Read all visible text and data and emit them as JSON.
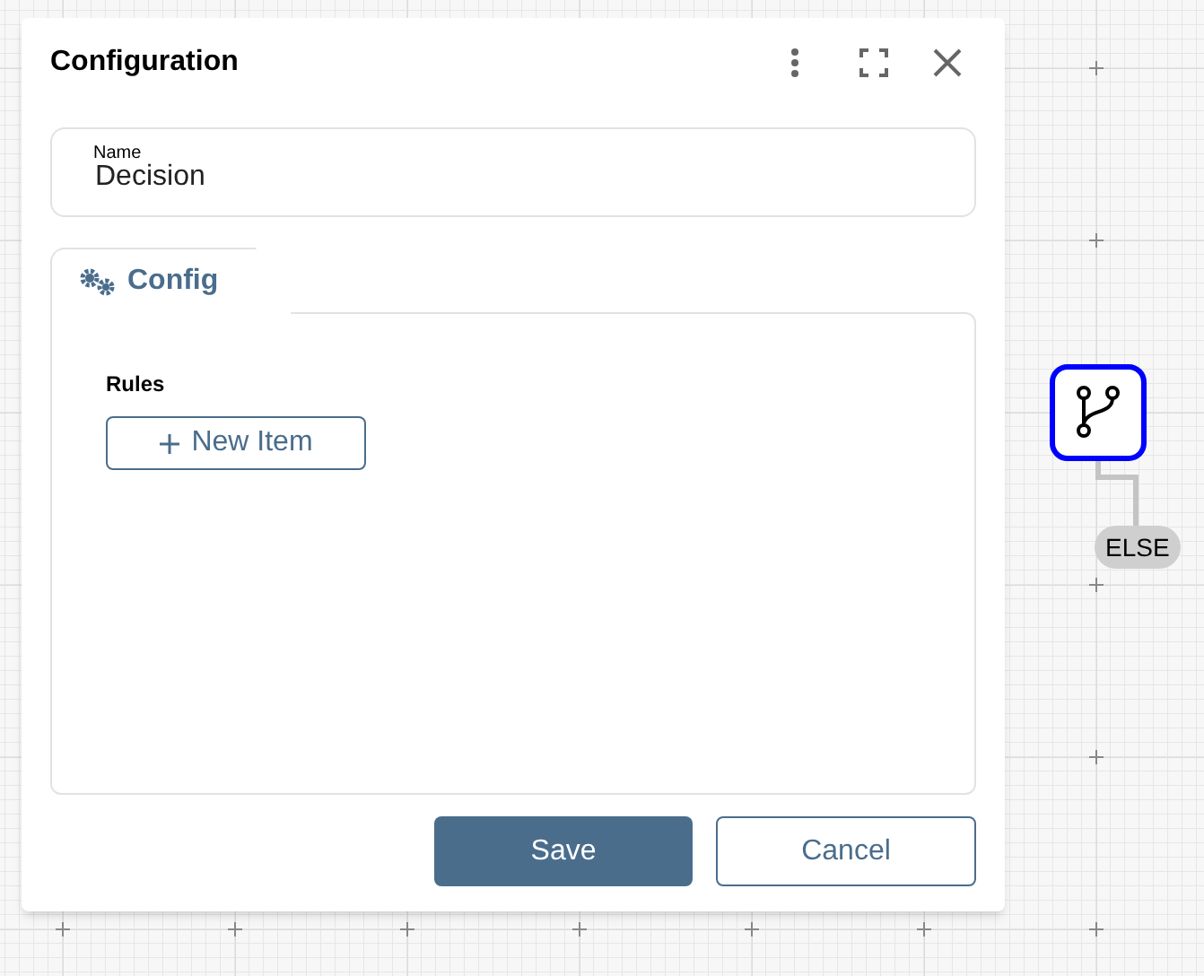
{
  "dialog": {
    "title": "Configuration",
    "name_field": {
      "label": "Name",
      "value": "Decision"
    },
    "tabs": [
      {
        "label": "Config",
        "selected": true
      }
    ],
    "rules": {
      "label": "Rules",
      "add_button": "New Item"
    },
    "buttons": [
      {
        "label": "Save",
        "kind": "primary"
      },
      {
        "label": "Cancel",
        "kind": "secondary"
      }
    ]
  },
  "canvas": {
    "node": {
      "selected": true,
      "edge_label": "ELSE"
    }
  }
}
